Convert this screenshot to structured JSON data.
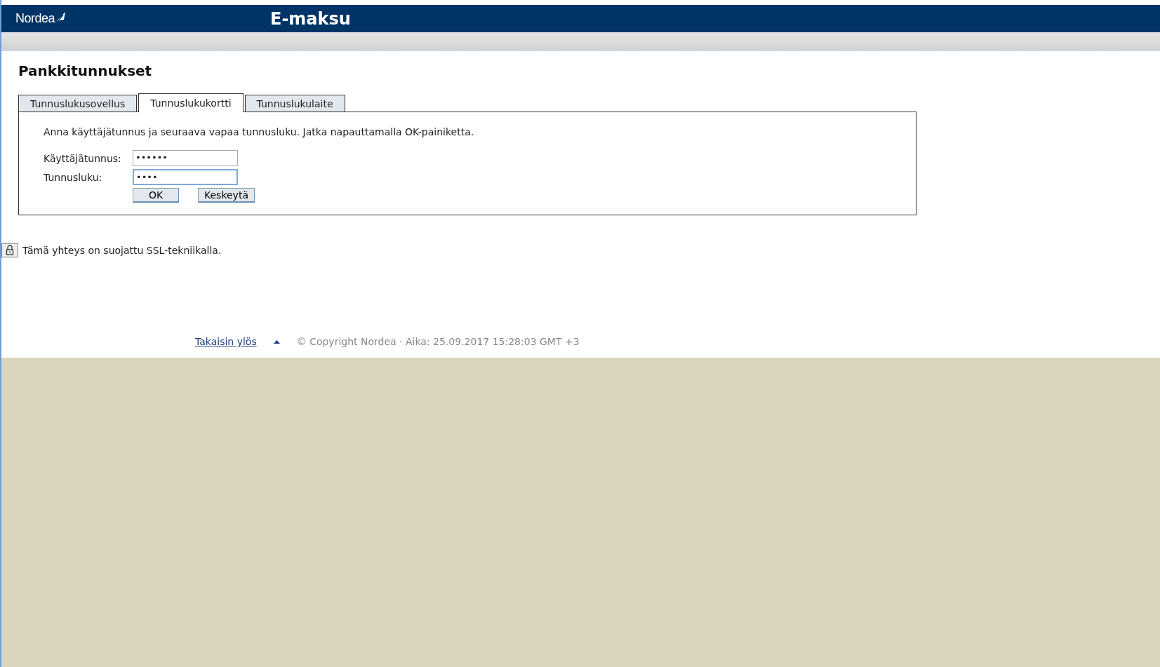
{
  "header": {
    "logo": "Nordea",
    "title": "E-maksu"
  },
  "page_title": "Pankkitunnukset",
  "tabs": [
    {
      "label": "Tunnuslukusovellus",
      "selected": false
    },
    {
      "label": "Tunnuslukukortti",
      "selected": true
    },
    {
      "label": "Tunnuslukulaite",
      "selected": false
    }
  ],
  "instructions": "Anna käyttäjätunnus ja seuraava vapaa tunnusluku. Jatka napauttamalla OK-painiketta.",
  "fields": [
    {
      "label": "Käyttäjätunnus:",
      "value": "••••••",
      "focused": false
    },
    {
      "label": "Tunnusluku:",
      "value": "••••",
      "focused": true
    }
  ],
  "buttons": [
    "OK",
    "Keskeytä"
  ],
  "security_note": "Tämä yhteys on suojattu SSL-tekniikalla.",
  "footer": {
    "back_to_top": "Takaisin ylös",
    "copyright": "© Copyright Nordea · Aika: 25.09.2017 15:28:03 GMT +3"
  }
}
